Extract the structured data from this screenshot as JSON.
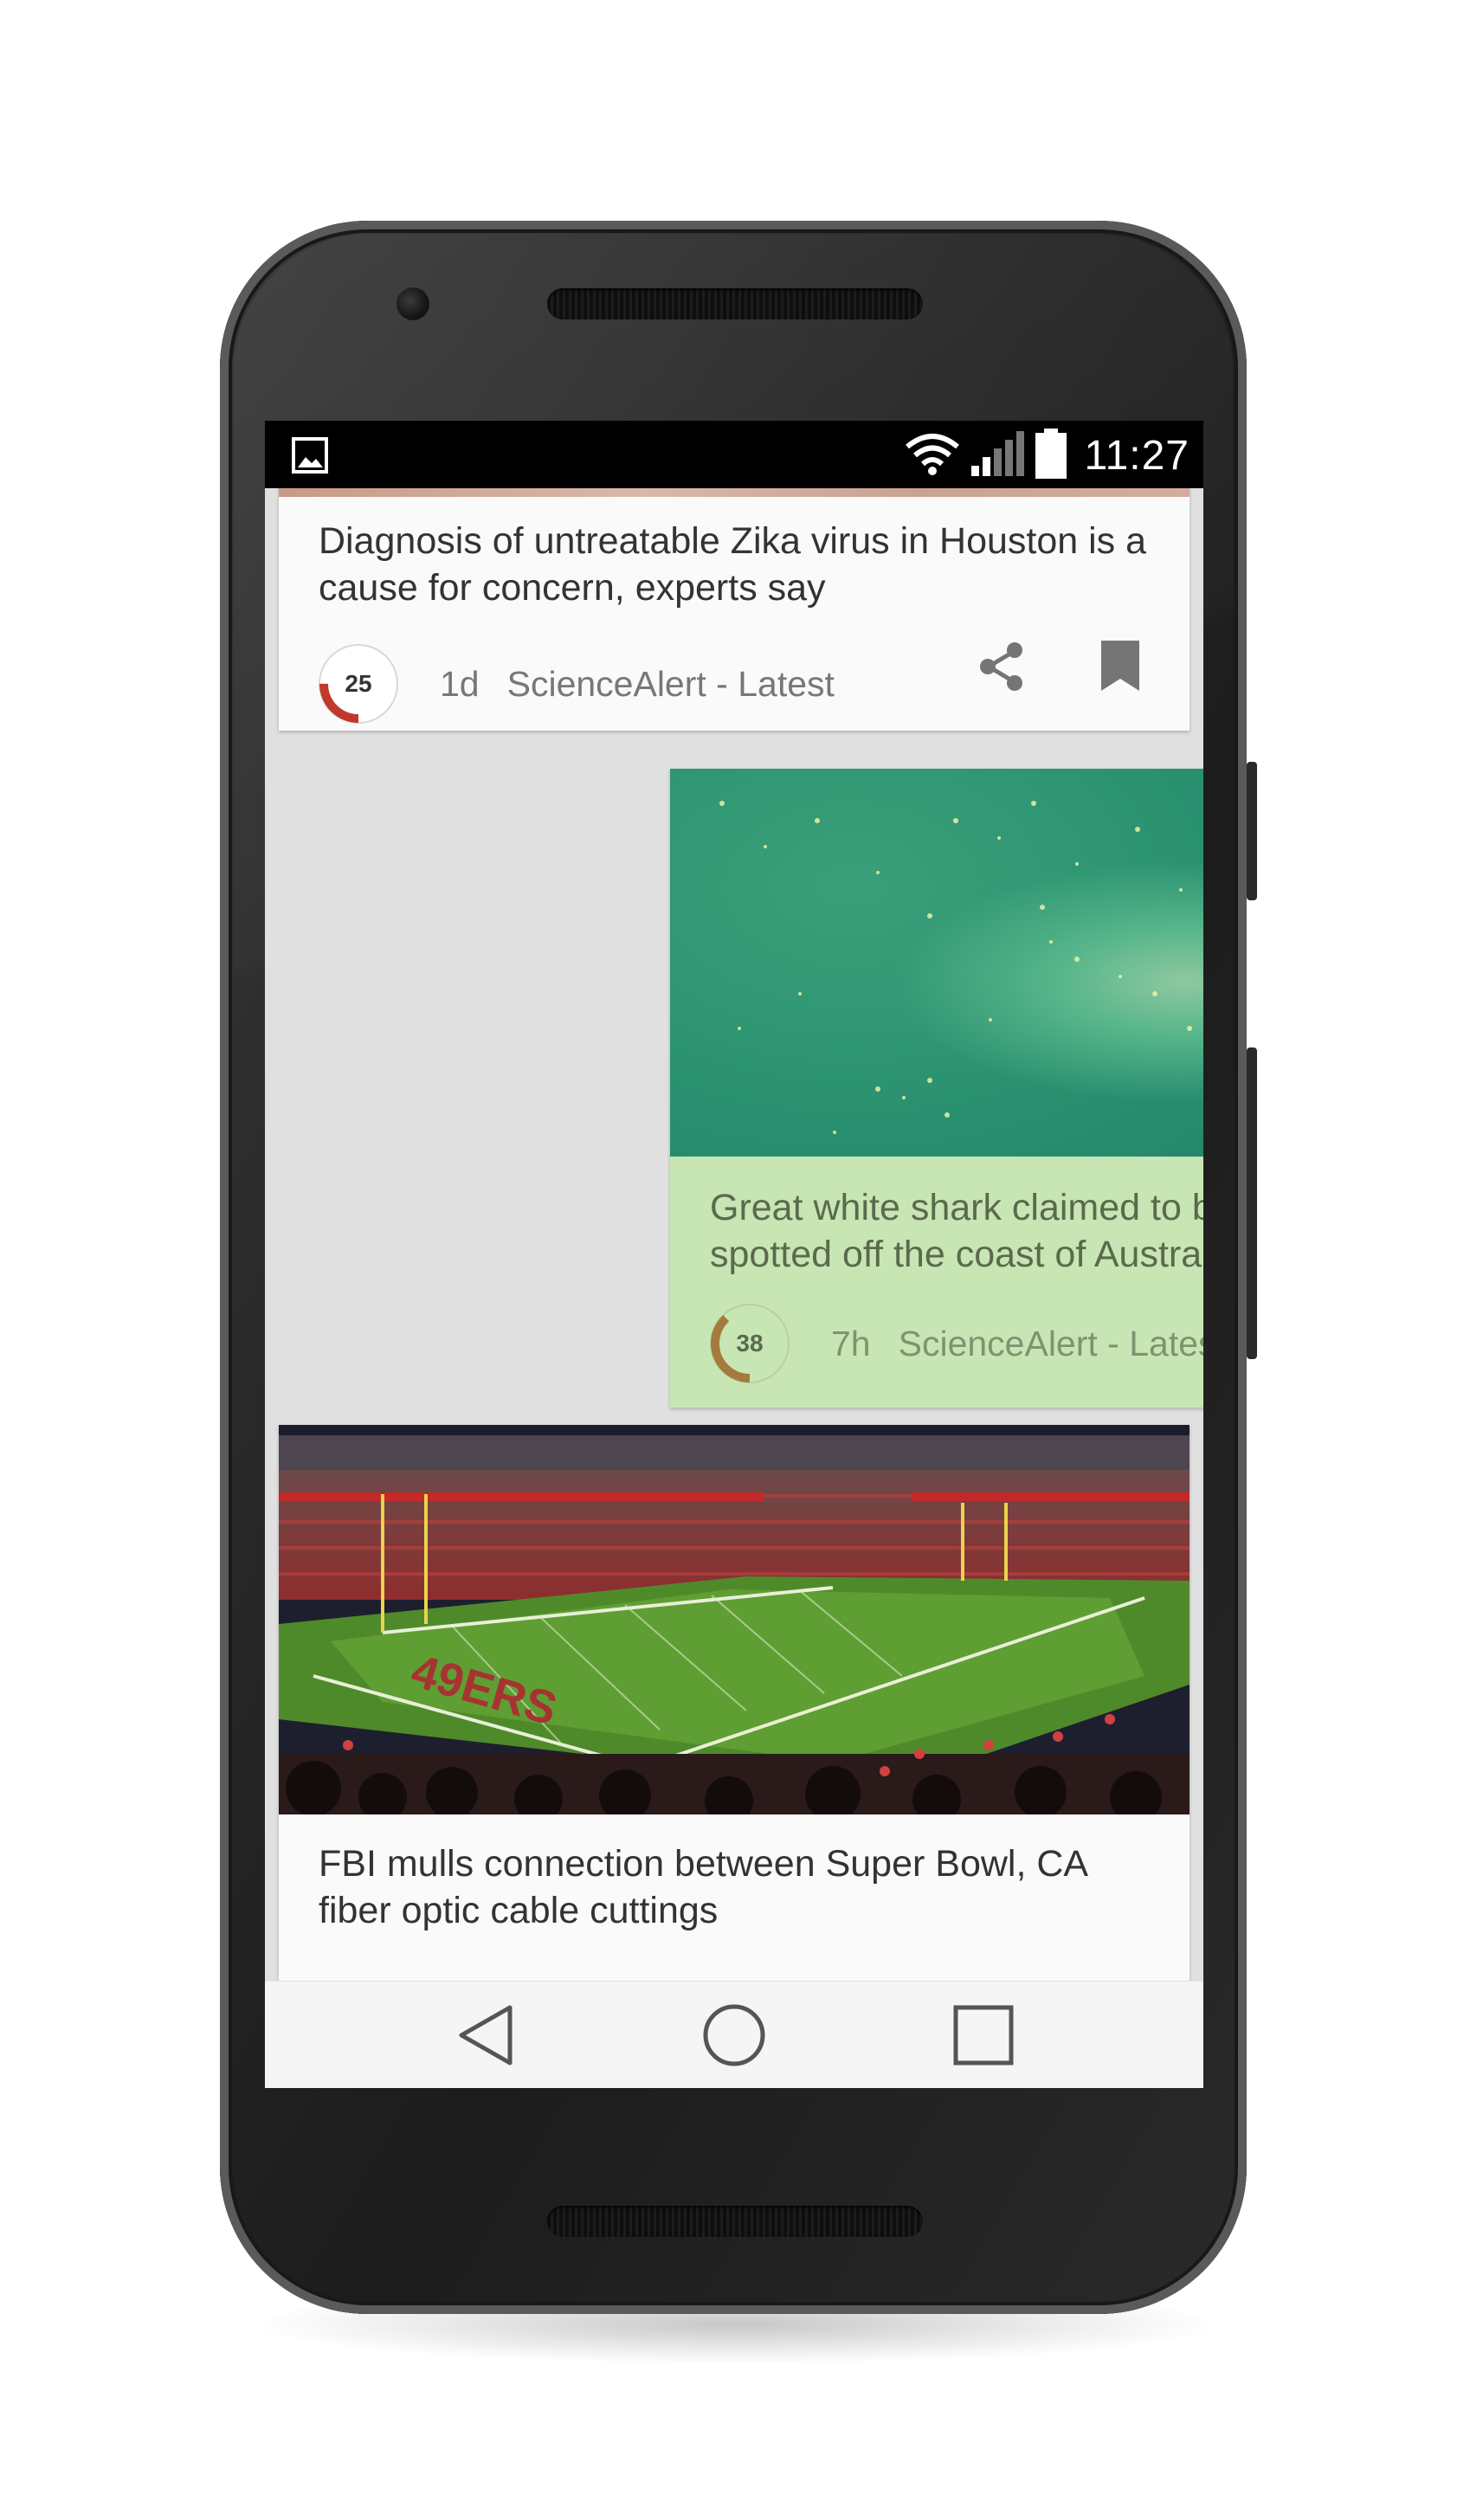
{
  "status_bar": {
    "time": "11:27",
    "left_icon": "image-notification-icon",
    "icons": [
      "wifi-icon",
      "signal-icon",
      "battery-icon"
    ]
  },
  "feed": {
    "cards": [
      {
        "title": "Diagnosis of untreatable Zika virus in Houston is a cause for concern, experts say",
        "score": "25",
        "score_fraction": 0.25,
        "age": "1d",
        "source": "ScienceAlert - Latest",
        "accent": "#c0392b"
      },
      {
        "title": "Great white shark claimed to be spotted off the coast of Australia",
        "score": "38",
        "score_fraction": 0.38,
        "age": "7h",
        "source": "ScienceAlert - Latest",
        "accent": "#a47a3e",
        "background": "#c8e6b4"
      },
      {
        "title": "FBI mulls connection between Super Bowl, CA fiber optic cable cuttings"
      }
    ],
    "actions": [
      "share-icon",
      "bookmark-icon"
    ]
  },
  "nav_bar": {
    "buttons": [
      "back-icon",
      "home-icon",
      "recents-icon"
    ]
  }
}
